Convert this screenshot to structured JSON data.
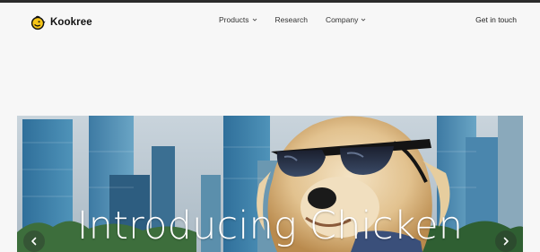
{
  "brand": {
    "name": "Kookree"
  },
  "nav": {
    "items": [
      {
        "label": "Products",
        "has_dropdown": true,
        "icon": "chevron-down-icon"
      },
      {
        "label": "Research",
        "has_dropdown": false
      },
      {
        "label": "Company",
        "has_dropdown": true,
        "icon": "chevron-down-icon"
      }
    ],
    "cta_label": "Get in touch"
  },
  "hero": {
    "title": "Introducing Chicken",
    "image": "dog-in-sunglasses-city-skyline",
    "prev_icon": "chevron-left-icon",
    "next_icon": "chevron-right-icon"
  },
  "colors": {
    "page_background": "#f7f7f7",
    "logo_accent": "#f5c518",
    "top_strip": "#2b2b2b",
    "hero_title": "#ffffff"
  }
}
